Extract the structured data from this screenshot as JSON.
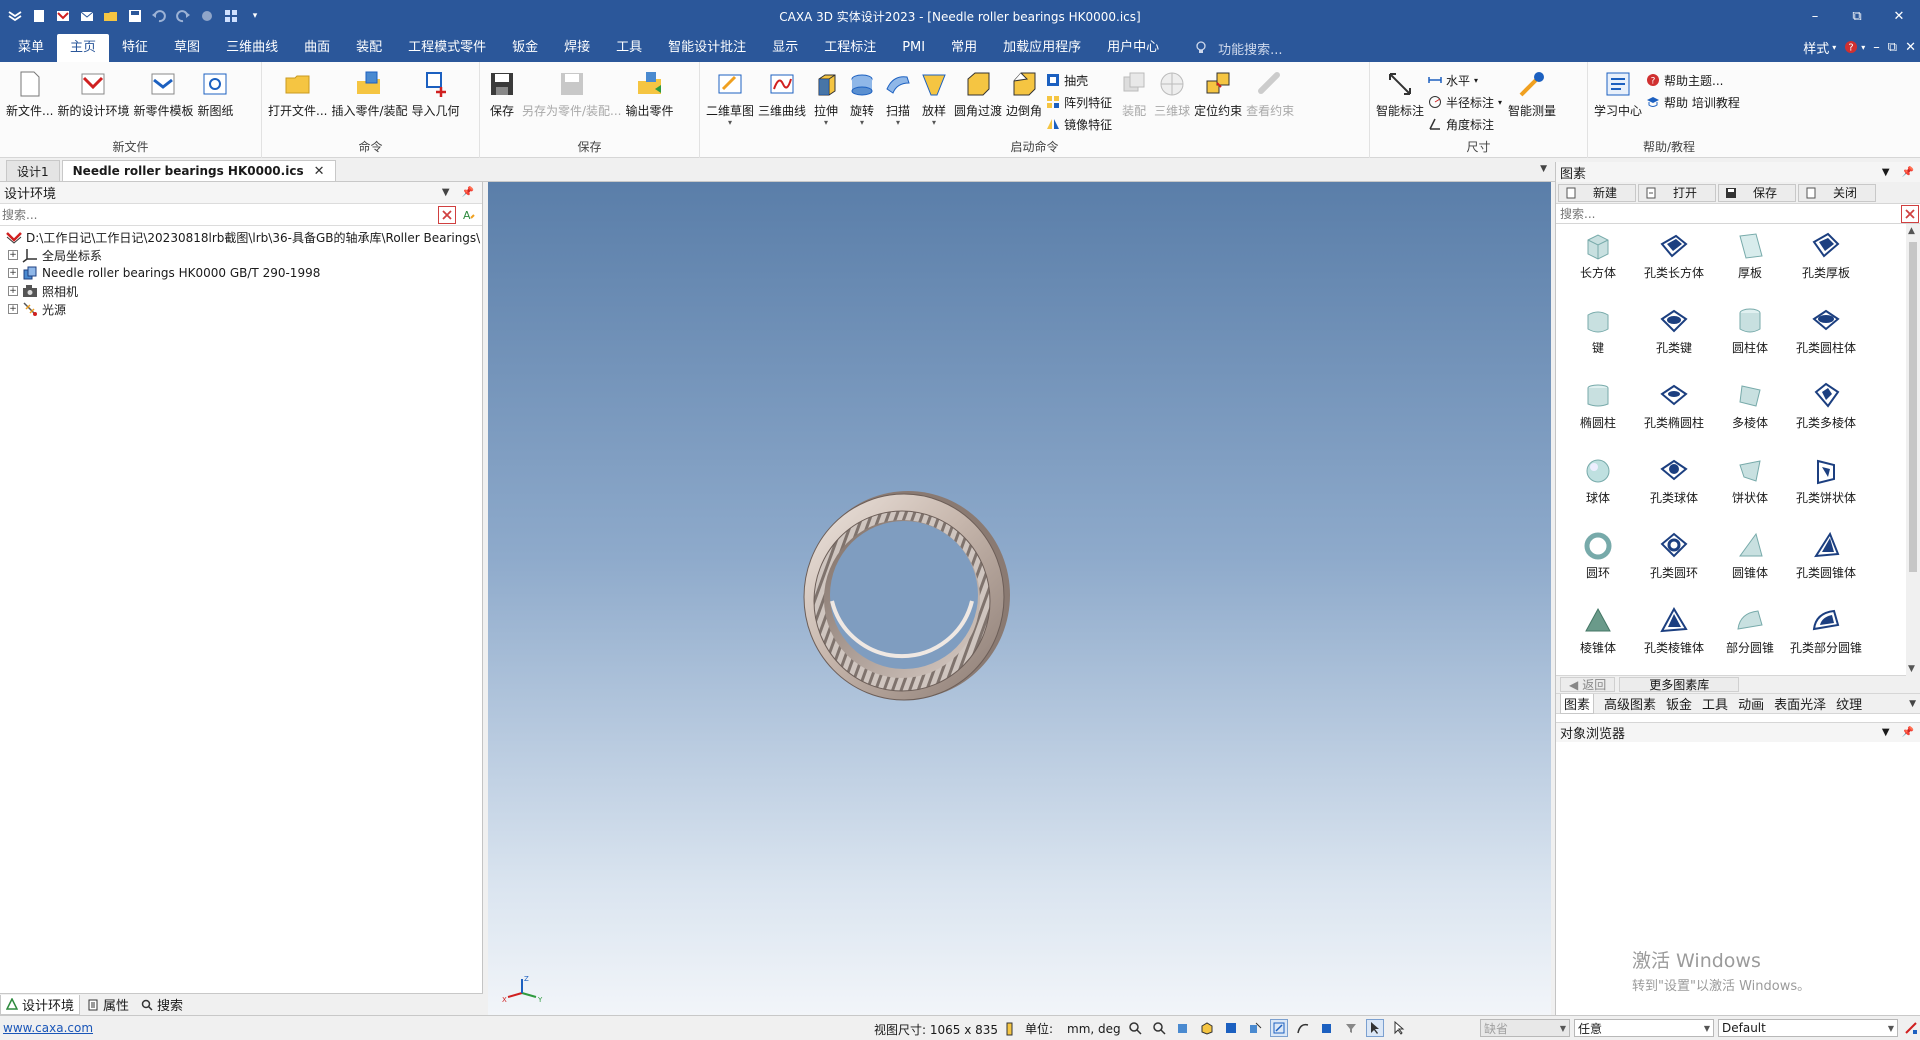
{
  "window": {
    "title": "CAXA 3D 实体设计2023 - [Needle roller bearings HK0000.ics]",
    "controls": {
      "minimize": "–",
      "restore": "⧉",
      "close": "✕"
    }
  },
  "menu": {
    "items": [
      "菜单",
      "主页",
      "特征",
      "草图",
      "三维曲线",
      "曲面",
      "装配",
      "工程模式零件",
      "钣金",
      "焊接",
      "工具",
      "智能设计批注",
      "显示",
      "工程标注",
      "PMI",
      "常用",
      "加载应用程序",
      "用户中心"
    ],
    "active_index": 1,
    "func_search_placeholder": "功能搜索...",
    "style_label": "样式"
  },
  "ribbon": {
    "groups": {
      "new_file": {
        "label": "新文件",
        "buttons": [
          "新文件...",
          "新的设计环境",
          "新零件模板",
          "新图纸"
        ]
      },
      "command": {
        "label": "命令",
        "buttons": [
          "打开文件...",
          "插入零件/装配",
          "导入几何"
        ]
      },
      "save": {
        "label": "保存",
        "buttons": [
          "保存",
          "另存为零件/装配...",
          "输出零件"
        ]
      },
      "launch": {
        "label": "启动命令",
        "buttons": [
          "二维草图",
          "三维曲线",
          "拉伸",
          "旋转",
          "扫描",
          "放样",
          "圆角过渡",
          "边倒角"
        ],
        "small": [
          "抽壳",
          "阵列特征",
          "镜像特征"
        ],
        "disabled": [
          "装配",
          "三维球"
        ],
        "after": [
          "定位约束"
        ],
        "disabled_after": [
          "查看约束"
        ]
      },
      "dimension": {
        "label": "尺寸",
        "buttons": [
          "智能标注"
        ],
        "small": [
          "水平",
          "半径标注",
          "角度标注"
        ],
        "after": [
          "智能测量"
        ]
      },
      "help": {
        "label": "帮助/教程",
        "buttons": [
          "学习中心"
        ],
        "small": [
          "帮助主题...",
          "帮助 培训教程"
        ]
      }
    }
  },
  "doc_tabs": [
    {
      "label": "设计1",
      "active": false
    },
    {
      "label": "Needle roller bearings HK0000.ics",
      "active": true
    }
  ],
  "left_panel": {
    "title": "设计环境",
    "search_placeholder": "搜索...",
    "tree": [
      {
        "label": "D:\\工作日记\\工作日记\\20230818lrb截图\\lrb\\36-具备GB的轴承库\\Roller Bearings\\",
        "icon": "design-env-icon",
        "indent": 0
      },
      {
        "label": "全局坐标系",
        "icon": "coordinate-system-icon",
        "indent": 1
      },
      {
        "label": "Needle roller bearings HK0000 GB/T 290-1998",
        "icon": "part-icon",
        "indent": 1
      },
      {
        "label": "照相机",
        "icon": "camera-icon",
        "indent": 1
      },
      {
        "label": "光源",
        "icon": "light-icon",
        "indent": 1
      }
    ],
    "bottom_tabs": [
      "设计环境",
      "属性",
      "搜索"
    ]
  },
  "right_panel": {
    "title": "图素",
    "toolbar": [
      "新建",
      "打开",
      "保存",
      "关闭"
    ],
    "search_placeholder": "搜索...",
    "shapes": [
      "长方体",
      "孔类长方体",
      "厚板",
      "孔类厚板",
      "键",
      "孔类键",
      "圆柱体",
      "孔类圆柱体",
      "椭圆柱",
      "孔类椭圆柱",
      "多棱体",
      "孔类多棱体",
      "球体",
      "孔类球体",
      "饼状体",
      "孔类饼状体",
      "圆环",
      "孔类圆环",
      "圆锥体",
      "孔类圆锥体",
      "棱锥体",
      "孔类棱锥体",
      "部分圆锥",
      "孔类部分圆锥"
    ],
    "nav": {
      "back": "返回",
      "more": "更多图素库"
    },
    "categories": [
      "图素",
      "高级图素",
      "钣金",
      "工具",
      "动画",
      "表面光泽",
      "纹理"
    ],
    "object_browser_title": "对象浏览器",
    "watermark_line1": "激活 Windows",
    "watermark_line2": "转到\"设置\"以激活 Windows。"
  },
  "statusbar": {
    "link": "www.caxa.com",
    "view_size": "视图尺寸: 1065 x  835",
    "unit_label": "单位:",
    "unit_value": "mm, deg",
    "select_default": "缺省",
    "select_mode": "任意",
    "select_style": "Default"
  },
  "colors": {
    "titlebar": "#2b579a",
    "accent": "#2b579a"
  }
}
